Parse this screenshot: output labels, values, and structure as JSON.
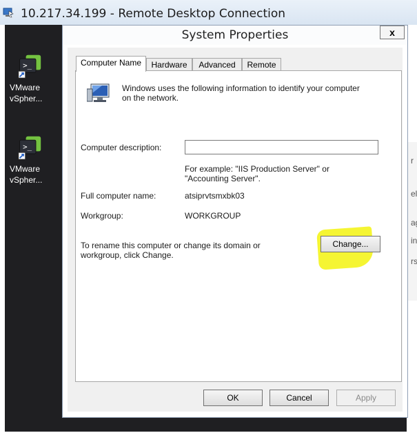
{
  "rdp": {
    "title": "10.217.34.199 - Remote Desktop Connection",
    "icon": "remote-desktop-icon"
  },
  "desktop": {
    "icons": [
      {
        "label_line1": "VMware",
        "label_line2": "vSpher...",
        "icon": "vsphere-console-icon"
      },
      {
        "label_line1": "VMware",
        "label_line2": "vSpher...",
        "icon": "vsphere-console-icon"
      }
    ],
    "right_chars": [
      "r",
      "el",
      "ag",
      "in",
      "rs"
    ]
  },
  "window": {
    "title": "System Properties",
    "close_label": "x",
    "tabs": [
      {
        "label": "Computer Name",
        "active": true
      },
      {
        "label": "Hardware",
        "active": false
      },
      {
        "label": "Advanced",
        "active": false
      },
      {
        "label": "Remote",
        "active": false
      }
    ],
    "intro_line1": "Windows uses the following information to identify your computer",
    "intro_line2": "on the network.",
    "description_label": "Computer description:",
    "description_value": "",
    "example_line1": "For example: \"IIS Production Server\" or",
    "example_line2": "\"Accounting Server\".",
    "full_name_label": "Full computer name:",
    "full_name_value": "atsiprvtsmxbk03",
    "workgroup_label": "Workgroup:",
    "workgroup_value": "WORKGROUP",
    "rename_line1": "To rename this computer or change its domain or",
    "rename_line2": "workgroup, click Change.",
    "change_label": "Change...",
    "ok_label": "OK",
    "cancel_label": "Cancel",
    "apply_label": "Apply",
    "highlight_color": "#f3f300"
  }
}
